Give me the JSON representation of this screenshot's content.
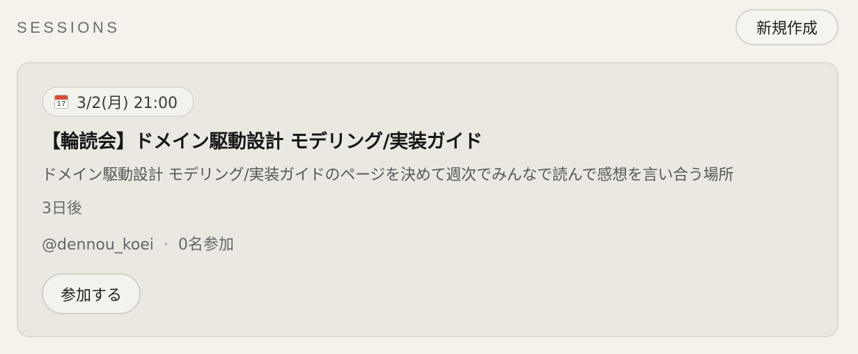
{
  "header": {
    "section_title": "SESSIONS",
    "new_button_label": "新規作成"
  },
  "session": {
    "date": "3/2(月) 21:00",
    "date_icon": "calendar-icon",
    "title": "【輪読会】ドメイン駆動設計 モデリング/実装ガイド",
    "description": "ドメイン駆動設計 モデリング/実装ガイドのページを決めて週次でみんなで読んで感想を言い合う場所",
    "relative_time": "3日後",
    "host": "@dennou_koei",
    "separator": "·",
    "participants": "0名参加",
    "join_label": "参加する"
  },
  "colors": {
    "background": "#f5f2eb",
    "card_background": "#ebe8e1",
    "border": "#ddd9d1",
    "text_primary": "#1f1f1f",
    "text_secondary": "#666666"
  }
}
